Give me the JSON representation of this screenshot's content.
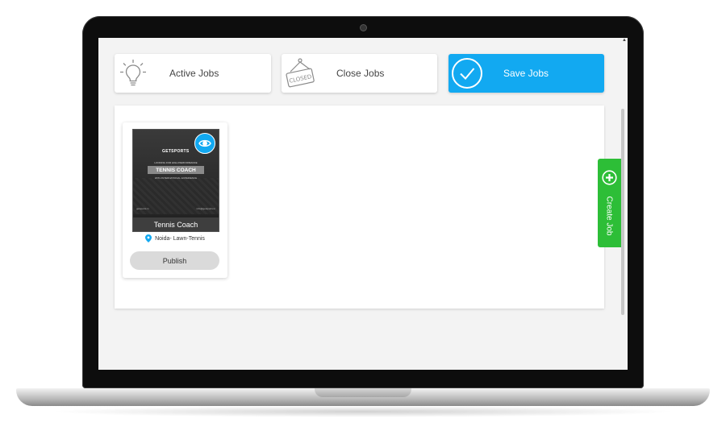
{
  "tabs": {
    "active": {
      "label": "Active Jobs",
      "icon": "lightbulb-icon"
    },
    "close": {
      "label": "Close Jobs",
      "icon": "closed-sign-icon",
      "sign_text": "CLOSED"
    },
    "save": {
      "label": "Save Jobs",
      "icon": "checkmark-circle-icon"
    }
  },
  "job_card": {
    "image": {
      "brand": "GETSPORTS",
      "tagline": "LOOKING FOR HIGH PERFORMANCE",
      "headline": "TENNIS COACH",
      "subline": "WITH INTERNATIONAL EXPERIENCE",
      "footer_left": "getsports.in",
      "footer_right": "info@getsports.in"
    },
    "title": "Tennis Coach",
    "location": "Noida- Lawn-Tennis",
    "view_icon": "eye-icon",
    "publish_label": "Publish"
  },
  "create_job": {
    "label": "Create Job",
    "icon": "plus-circle-icon"
  },
  "colors": {
    "accent": "#12a9f1",
    "create": "#2dbe37",
    "publish_bg": "#dadada"
  }
}
